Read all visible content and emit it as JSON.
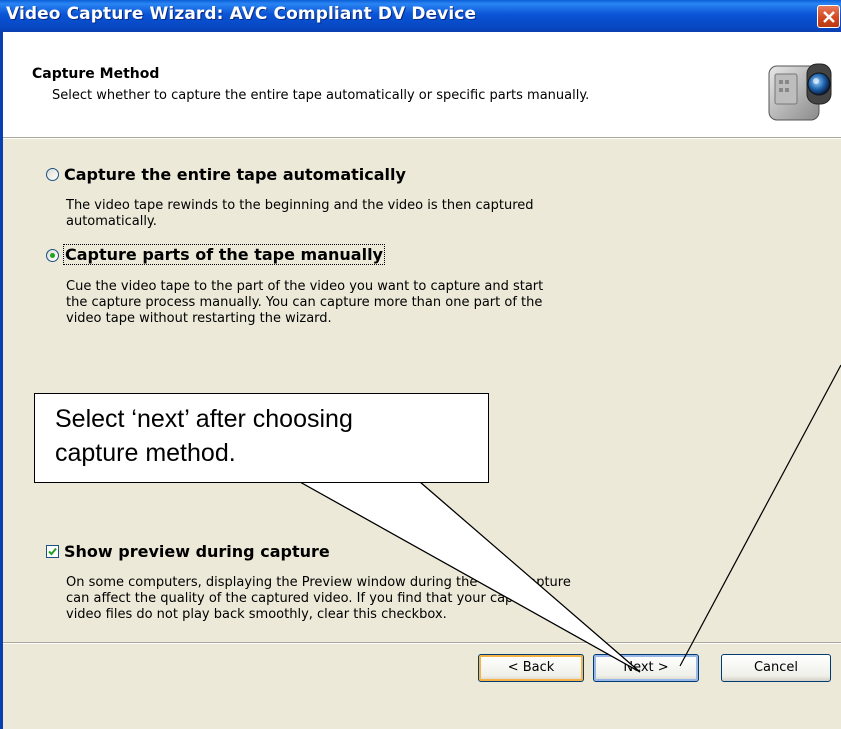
{
  "window": {
    "title": "Video Capture Wizard: AVC Compliant DV Device"
  },
  "header": {
    "title": "Capture Method",
    "subtitle": "Select whether to capture the entire tape automatically or specific parts manually.",
    "icon": "video-camera-icon"
  },
  "options": [
    {
      "label": "Capture the entire tape automatically",
      "selected": false,
      "description_lines": [
        "The video tape rewinds to the beginning and the video is then captured",
        "automatically."
      ]
    },
    {
      "label": "Capture parts of the tape manually",
      "selected": true,
      "description_lines": [
        "Cue the video tape to the part of the video you want to capture and start",
        "the capture process manually. You can capture more than one part of the",
        "video tape without restarting the wizard."
      ]
    }
  ],
  "preview": {
    "label": "Show preview during capture",
    "checked": true,
    "description_lines": [
      "On some computers, displaying the Preview window during the video capture",
      "can affect the quality of the captured video. If you find that your captured",
      "video files do not play back smoothly, clear this checkbox."
    ]
  },
  "buttons": {
    "back": "< Back",
    "next": "Next >",
    "cancel": "Cancel"
  },
  "callout": {
    "lines": [
      "Select ‘next’ after choosing",
      "capture method."
    ]
  },
  "colors": {
    "titlebar": "#0a54d6",
    "dialog_bg": "#ece9d8",
    "close_button": "#d0461f",
    "radio_dot": "#21a121"
  }
}
